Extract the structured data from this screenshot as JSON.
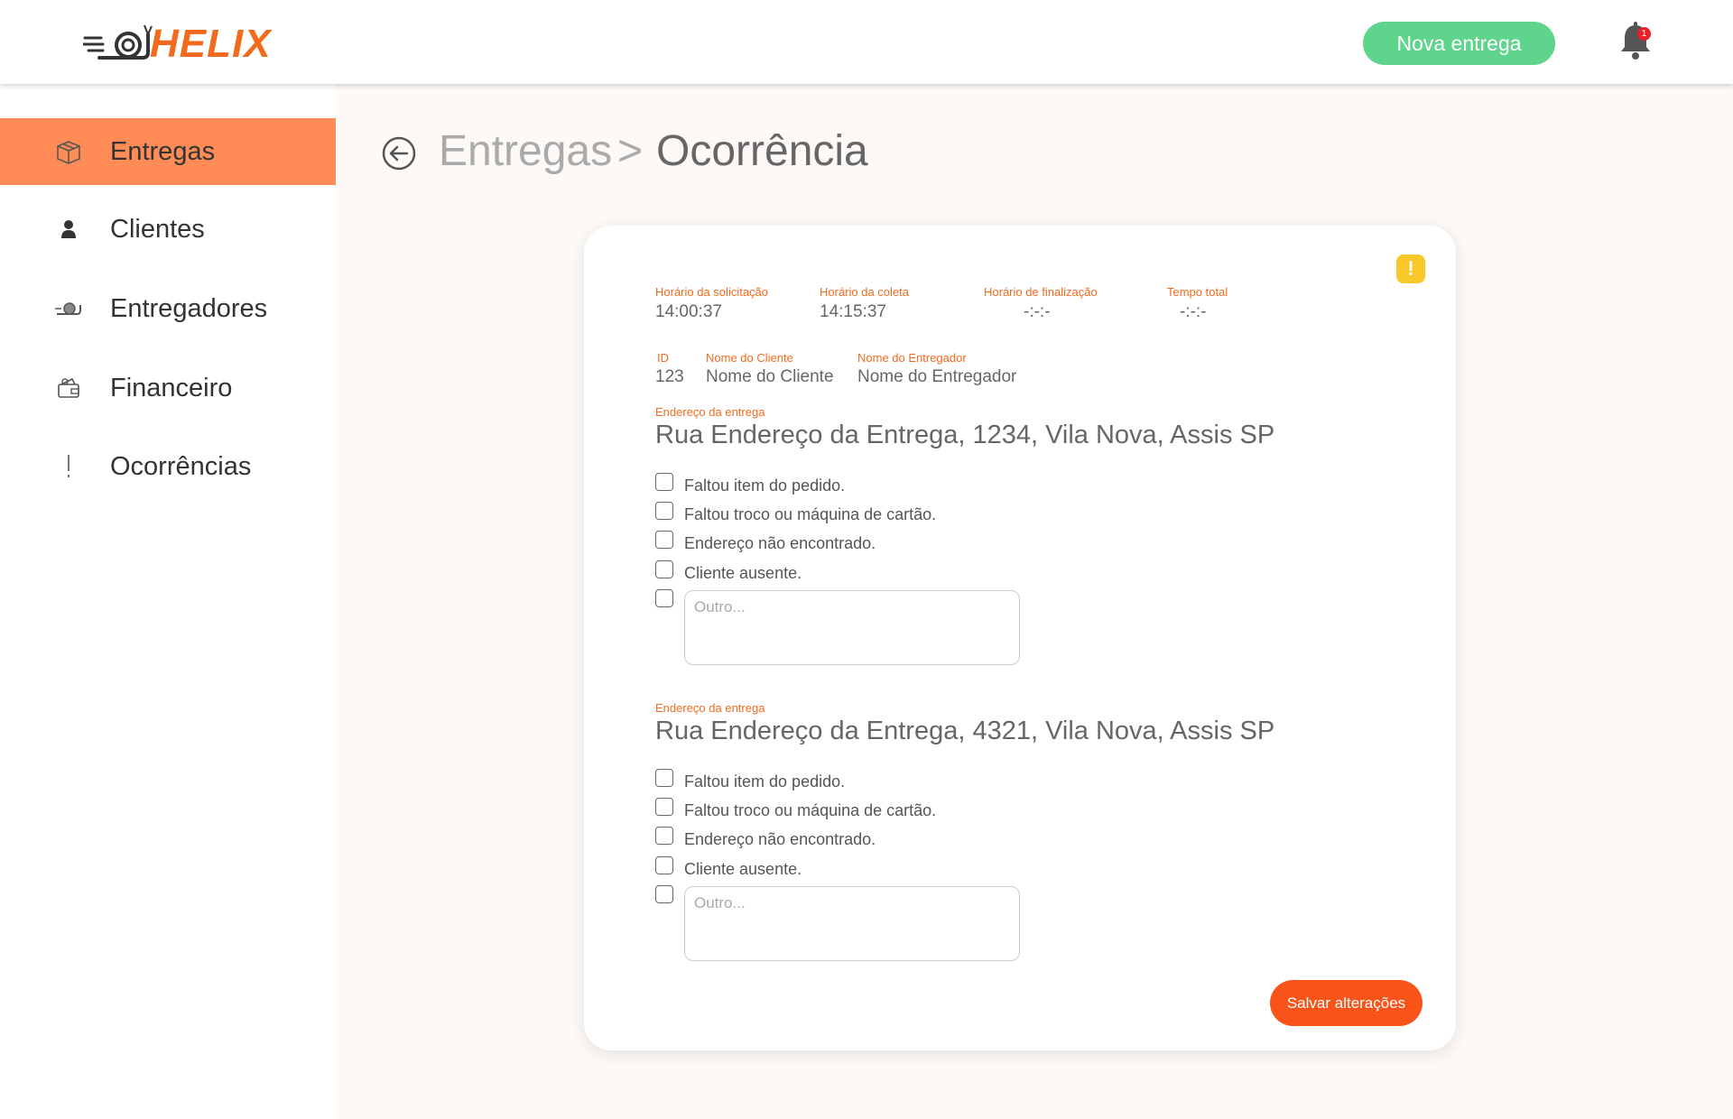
{
  "header": {
    "logo_text": "HELIX",
    "new_delivery_label": "Nova entrega",
    "notification_count": "1"
  },
  "sidebar": {
    "items": [
      {
        "label": "Entregas",
        "icon": "box-icon",
        "active": true
      },
      {
        "label": "Clientes",
        "icon": "person-icon"
      },
      {
        "label": "Entregadores",
        "icon": "snail-icon"
      },
      {
        "label": "Financeiro",
        "icon": "wallet-icon"
      },
      {
        "label": "Ocorrências",
        "icon": "exclamation-icon"
      }
    ]
  },
  "breadcrumb": {
    "root": "Entregas",
    "separator": ">",
    "current": "Ocorrência"
  },
  "card": {
    "times": {
      "request_label": "Horário da solicitação",
      "request_value": "14:00:37",
      "pickup_label": "Horário da coleta",
      "pickup_value": "14:15:37",
      "finish_label": "Horário de finalização",
      "finish_value": "-:-:-",
      "total_label": "Tempo total",
      "total_value": "-:-:-"
    },
    "info": {
      "id_label": "ID",
      "id_value": "123",
      "client_label": "Nome do Cliente",
      "client_value": "Nome do Cliente",
      "courier_label": "Nome do Entregador",
      "courier_value": "Nome do Entregador"
    },
    "deliveries": [
      {
        "address_label": "Endereço da entrega",
        "address": "Rua Endereço da Entrega, 1234, Vila Nova, Assis SP",
        "options": [
          "Faltou item do pedido.",
          "Faltou troco ou máquina de cartão.",
          "Endereço não encontrado.",
          "Cliente ausente."
        ],
        "other_placeholder": "Outro..."
      },
      {
        "address_label": "Endereço da entrega",
        "address": "Rua Endereço da Entrega, 4321, Vila Nova, Assis SP",
        "options": [
          "Faltou item do pedido.",
          "Faltou troco ou máquina de cartão.",
          "Endereço não encontrado.",
          "Cliente ausente."
        ],
        "other_placeholder": "Outro..."
      }
    ],
    "save_label": "Salvar alterações"
  },
  "colors": {
    "accent": "#f36a1d",
    "active_nav": "#ff8c57",
    "new_button": "#5fd48c",
    "save_button": "#f8541a",
    "warning": "#f9c82a"
  }
}
